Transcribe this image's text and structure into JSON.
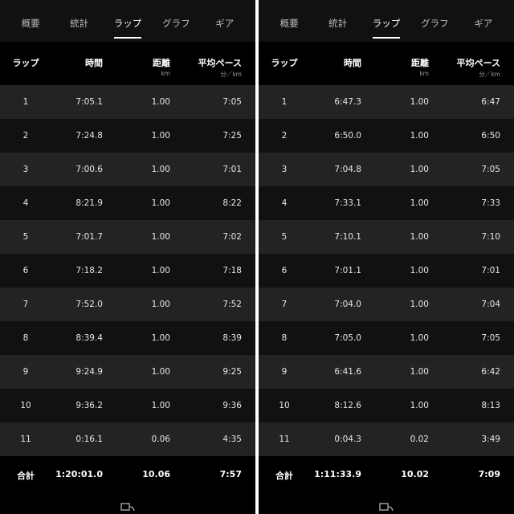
{
  "tabs": [
    "概要",
    "統計",
    "ラップ",
    "グラフ",
    "ギア"
  ],
  "active_tab": 2,
  "columns": {
    "lap": "ラップ",
    "time": "時間",
    "distance": "距離",
    "distance_unit": "km",
    "pace": "平均ペース",
    "pace_unit": "分／km"
  },
  "panels": [
    {
      "laps": [
        {
          "lap": "1",
          "time": "7:05.1",
          "distance": "1.00",
          "pace": "7:05"
        },
        {
          "lap": "2",
          "time": "7:24.8",
          "distance": "1.00",
          "pace": "7:25"
        },
        {
          "lap": "3",
          "time": "7:00.6",
          "distance": "1.00",
          "pace": "7:01"
        },
        {
          "lap": "4",
          "time": "8:21.9",
          "distance": "1.00",
          "pace": "8:22"
        },
        {
          "lap": "5",
          "time": "7:01.7",
          "distance": "1.00",
          "pace": "7:02"
        },
        {
          "lap": "6",
          "time": "7:18.2",
          "distance": "1.00",
          "pace": "7:18"
        },
        {
          "lap": "7",
          "time": "7:52.0",
          "distance": "1.00",
          "pace": "7:52"
        },
        {
          "lap": "8",
          "time": "8:39.4",
          "distance": "1.00",
          "pace": "8:39"
        },
        {
          "lap": "9",
          "time": "9:24.9",
          "distance": "1.00",
          "pace": "9:25"
        },
        {
          "lap": "10",
          "time": "9:36.2",
          "distance": "1.00",
          "pace": "9:36"
        },
        {
          "lap": "11",
          "time": "0:16.1",
          "distance": "0.06",
          "pace": "4:35"
        }
      ],
      "total": {
        "label": "合計",
        "time": "1:20:01.0",
        "distance": "10.06",
        "pace": "7:57"
      }
    },
    {
      "laps": [
        {
          "lap": "1",
          "time": "6:47.3",
          "distance": "1.00",
          "pace": "6:47"
        },
        {
          "lap": "2",
          "time": "6:50.0",
          "distance": "1.00",
          "pace": "6:50"
        },
        {
          "lap": "3",
          "time": "7:04.8",
          "distance": "1.00",
          "pace": "7:05"
        },
        {
          "lap": "4",
          "time": "7:33.1",
          "distance": "1.00",
          "pace": "7:33"
        },
        {
          "lap": "5",
          "time": "7:10.1",
          "distance": "1.00",
          "pace": "7:10"
        },
        {
          "lap": "6",
          "time": "7:01.1",
          "distance": "1.00",
          "pace": "7:01"
        },
        {
          "lap": "7",
          "time": "7:04.0",
          "distance": "1.00",
          "pace": "7:04"
        },
        {
          "lap": "8",
          "time": "7:05.0",
          "distance": "1.00",
          "pace": "7:05"
        },
        {
          "lap": "9",
          "time": "6:41.6",
          "distance": "1.00",
          "pace": "6:42"
        },
        {
          "lap": "10",
          "time": "8:12.6",
          "distance": "1.00",
          "pace": "8:13"
        },
        {
          "lap": "11",
          "time": "0:04.3",
          "distance": "0.02",
          "pace": "3:49"
        }
      ],
      "total": {
        "label": "合計",
        "time": "1:11:33.9",
        "distance": "10.02",
        "pace": "7:09"
      }
    }
  ],
  "colors": {
    "background": "#000000",
    "tab_bar": "#111111",
    "row_odd": "#232323",
    "row_even": "#111111",
    "text": "#e6e6e6"
  },
  "icons": {
    "footer": "cast-icon"
  }
}
